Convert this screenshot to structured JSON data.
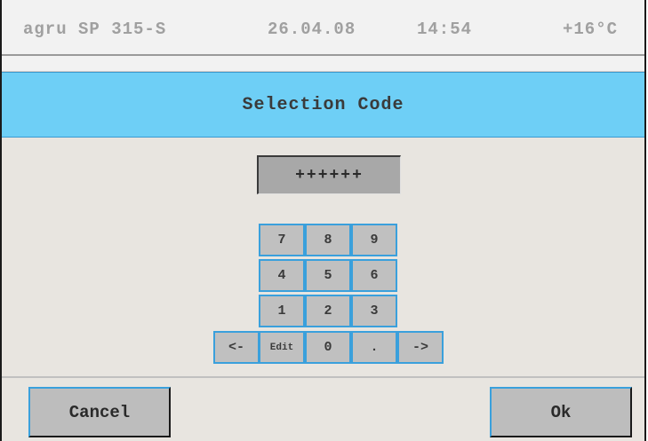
{
  "status": {
    "device": "agru SP 315-S",
    "date": "26.04.08",
    "time": "14:54",
    "temperature": "+16°C"
  },
  "title": "Selection Code",
  "code_field": {
    "value": "++++++"
  },
  "keypad": {
    "keys": [
      "7",
      "8",
      "9",
      "4",
      "5",
      "6",
      "1",
      "2",
      "3",
      "<-",
      "Edit",
      "0",
      ".",
      "->"
    ]
  },
  "buttons": {
    "cancel": "Cancel",
    "ok": "Ok"
  },
  "colors": {
    "accent": "#6ecff6",
    "key_border": "#3aa0dc",
    "background": "#e8e5e0"
  }
}
